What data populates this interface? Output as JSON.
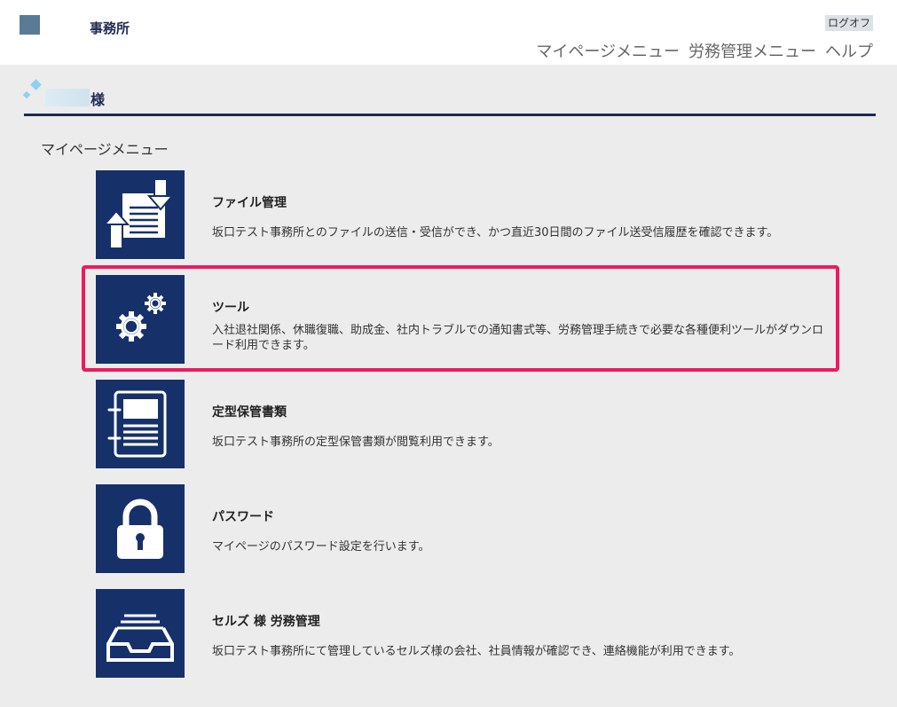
{
  "header": {
    "office_name": "事務所",
    "logout_label": "ログオフ",
    "nav": [
      "マイページメニュー",
      "労務管理メニュー",
      "ヘルプ"
    ]
  },
  "user": {
    "suffix": "様"
  },
  "section": {
    "title": "マイページメニュー"
  },
  "menu": [
    {
      "icon": "file-transfer-icon",
      "title": "ファイル管理",
      "desc": "坂口テスト事務所とのファイルの送信・受信ができ、かつ直近30日間のファイル送受信履歴を確認できます。"
    },
    {
      "icon": "gears-icon",
      "title": "ツール",
      "desc": "入社退社関係、休職復職、助成金、社内トラブルでの通知書式等、労務管理手続きで必要な各種便利ツールがダウンロード利用できます。"
    },
    {
      "icon": "document-binder-icon",
      "title": "定型保管書類",
      "desc": "坂口テスト事務所の定型保管書類が閲覧利用できます。"
    },
    {
      "icon": "padlock-icon",
      "title": "パスワード",
      "desc": "マイページのパスワード設定を行います。"
    },
    {
      "icon": "inbox-tray-icon",
      "title": "セルズ 様 労務管理",
      "desc": "坂口テスト事務所にて管理しているセルズ様の会社、社員情報が確認でき、連絡機能が利用できます。"
    }
  ],
  "colors": {
    "tile_background": "#16306a",
    "highlight": "#ee1a5f",
    "heading_rule": "#1e2a52"
  }
}
